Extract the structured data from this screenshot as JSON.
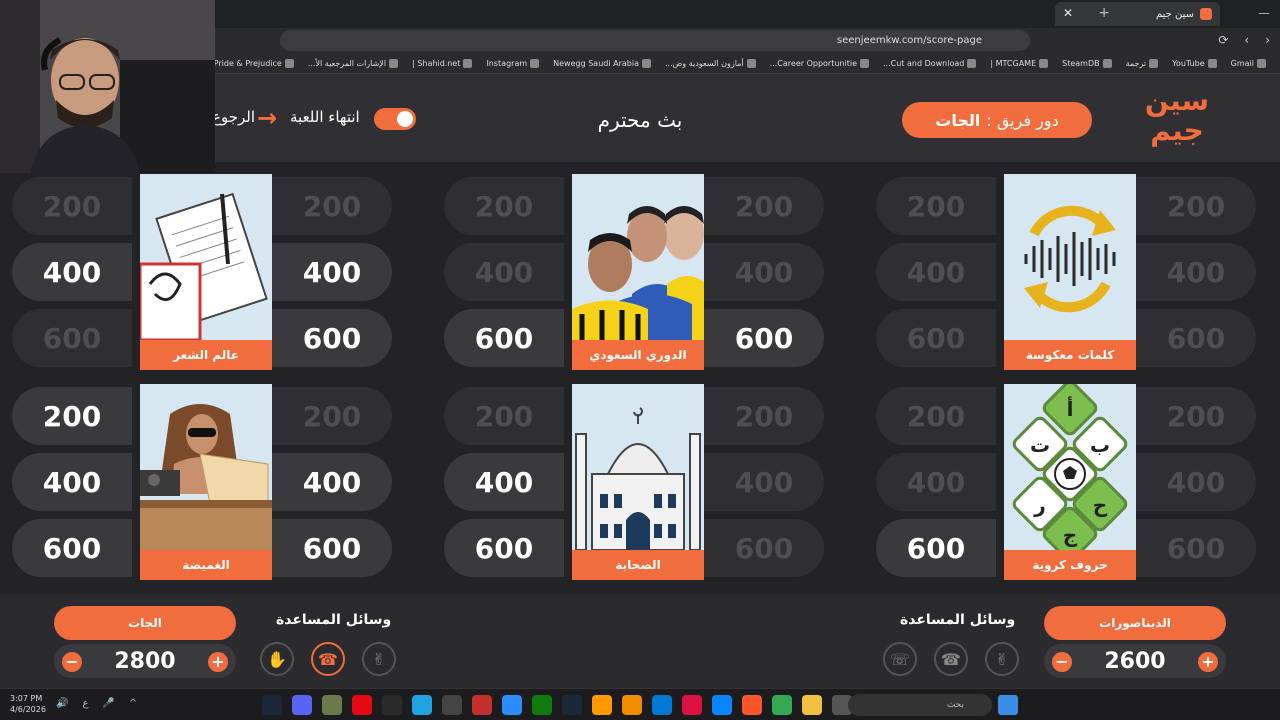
{
  "browser": {
    "tab_title": "سين جيم",
    "url": "seenjeemkw.com/score-page",
    "bookmarks": [
      "Gmail",
      "YouTube",
      "ترجمة",
      "SteamDB",
      "MTCGAME |",
      "Cut and Download...",
      "Career Opportunitie...",
      "أمازون السعودية وض...",
      "Newegg Saudi Arabia",
      "Instagram",
      "Shahid.net |",
      "الإشارات المرجعية الأ...",
      "Pride & Prejudice -..."
    ]
  },
  "header": {
    "logo_text": "سين جيم",
    "turn_prefix": "دور فريق :",
    "turn_team": "الجات",
    "game_title": "بث محترم",
    "end_game": "انتهاء اللعبة",
    "back": "الرجوع"
  },
  "categories": [
    {
      "name": "عالم الشعر",
      "left": [
        {
          "v": "200",
          "used": true
        },
        {
          "v": "400",
          "used": false
        },
        {
          "v": "600",
          "used": true
        }
      ],
      "right": [
        {
          "v": "200",
          "used": true
        },
        {
          "v": "400",
          "used": false
        },
        {
          "v": "600",
          "used": false
        }
      ]
    },
    {
      "name": "الدوري السعودي",
      "left": [
        {
          "v": "200",
          "used": true
        },
        {
          "v": "400",
          "used": true
        },
        {
          "v": "600",
          "used": false
        }
      ],
      "right": [
        {
          "v": "200",
          "used": true
        },
        {
          "v": "400",
          "used": true
        },
        {
          "v": "600",
          "used": false
        }
      ]
    },
    {
      "name": "كلمات معكوسة",
      "left": [
        {
          "v": "200",
          "used": true
        },
        {
          "v": "400",
          "used": true
        },
        {
          "v": "600",
          "used": true
        }
      ],
      "right": [
        {
          "v": "200",
          "used": true
        },
        {
          "v": "400",
          "used": true
        },
        {
          "v": "600",
          "used": true
        }
      ]
    },
    {
      "name": "الغميضة",
      "left": [
        {
          "v": "200",
          "used": false
        },
        {
          "v": "400",
          "used": false
        },
        {
          "v": "600",
          "used": false
        }
      ],
      "right": [
        {
          "v": "200",
          "used": true
        },
        {
          "v": "400",
          "used": false
        },
        {
          "v": "600",
          "used": false
        }
      ]
    },
    {
      "name": "الصحابة",
      "left": [
        {
          "v": "200",
          "used": true
        },
        {
          "v": "400",
          "used": false
        },
        {
          "v": "600",
          "used": false
        }
      ],
      "right": [
        {
          "v": "200",
          "used": true
        },
        {
          "v": "400",
          "used": true
        },
        {
          "v": "600",
          "used": true
        }
      ]
    },
    {
      "name": "حروف كروية",
      "left": [
        {
          "v": "200",
          "used": true
        },
        {
          "v": "400",
          "used": true
        },
        {
          "v": "600",
          "used": false
        }
      ],
      "right": [
        {
          "v": "200",
          "used": true
        },
        {
          "v": "400",
          "used": true
        },
        {
          "v": "600",
          "used": true
        }
      ]
    }
  ],
  "teams": {
    "left": {
      "name": "الجات",
      "score": "2800"
    },
    "right": {
      "name": "الديناصورات",
      "score": "2600"
    }
  },
  "aids_title": "وسائل المساعدة",
  "taskbar": {
    "time": "3:07 PM",
    "date": "4/6/2026",
    "search": "بحث",
    "lang": "ع"
  },
  "colors": {
    "accent": "#f26d3d",
    "bg": "#232327"
  }
}
